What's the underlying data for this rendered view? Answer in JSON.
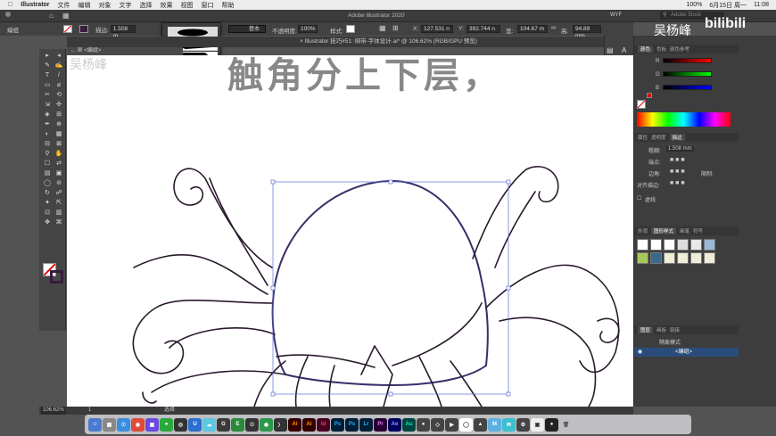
{
  "menubar": {
    "app": "Illustrator",
    "items": [
      "文件",
      "编辑",
      "对象",
      "文字",
      "选择",
      "效果",
      "视图",
      "窗口",
      "帮助"
    ],
    "right": [
      "100%",
      "6月15日 周一",
      "11:08"
    ]
  },
  "appbar": {
    "title": "Adobe Illustrator 2020",
    "workspace": "WYF",
    "search_placeholder": "Adobe Stock"
  },
  "ctrlbar": {
    "group_label": "编组",
    "stroke_label": "描边:",
    "stroke_value": "1.508 m",
    "brush_label": "基本",
    "opacity_label": "不透明度:",
    "opacity_value": "100%",
    "style_label": "样式:",
    "x_label": "X:",
    "x_value": "127.531 n",
    "y_label": "Y:",
    "y_value": "392.744 n",
    "w_label": "宽:",
    "w_value": "104.67 m",
    "h_label": "高:",
    "h_value": "94.89 mm"
  },
  "document": {
    "tab": "Illustrator 技巧#51: 绑带-字体设计.ai* @ 106.62% (RGB/GPU 预览)",
    "breadcrumb": "<编组>",
    "zoom": "106.62%",
    "page": "1",
    "status": "选择"
  },
  "canvas_text": {
    "subtitle": "触角分上下层，"
  },
  "watermark": {
    "name": "吴杨峰",
    "site": "bilibili"
  },
  "right_panel": {
    "top_tabs": [
      "颜色",
      "色板",
      "颜色参考"
    ],
    "color_labels": [
      "R",
      "G",
      "B"
    ],
    "stroke_tabs": [
      "属性",
      "透明度",
      "描边"
    ],
    "weight_label": "粗细:",
    "weight_value": "1.508 mm",
    "cap_label": "端点:",
    "corner_label": "边角:",
    "limit_label": "限制:",
    "align_label": "对齐描边:",
    "dashed_label": "虚线",
    "graphic_tabs": [
      "外观",
      "图形样式",
      "画笔",
      "符号"
    ],
    "layer_tabs": [
      "图层",
      "画板",
      "链接"
    ],
    "layer_name": "隔离模式",
    "sublayer_name": "<编组>"
  },
  "dock": {
    "apps": [
      "Ai",
      "Ai",
      "Id",
      "Ps",
      "Ps",
      "Lr",
      "Pr",
      "Ae",
      "Au",
      "M"
    ]
  },
  "colors": {
    "stroke": "#2b1a2e",
    "selection": "#5a6ed6",
    "accent": "#2a74d6"
  }
}
